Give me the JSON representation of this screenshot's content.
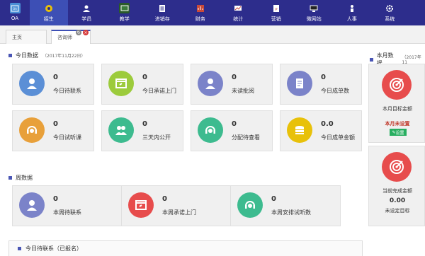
{
  "nav": [
    {
      "label": "OA",
      "icon": "oa-icon",
      "active": false
    },
    {
      "label": "招生",
      "icon": "enrollment-icon",
      "active": true
    },
    {
      "label": "学员",
      "icon": "student-icon",
      "active": false
    },
    {
      "label": "教学",
      "icon": "teaching-icon",
      "active": false
    },
    {
      "label": "进销存",
      "icon": "inventory-icon",
      "active": false
    },
    {
      "label": "财务",
      "icon": "finance-icon",
      "active": false
    },
    {
      "label": "统计",
      "icon": "statistics-icon",
      "active": false
    },
    {
      "label": "营销",
      "icon": "marketing-icon",
      "active": false
    },
    {
      "label": "微网站",
      "icon": "microsite-icon",
      "active": false
    },
    {
      "label": "人事",
      "icon": "hr-icon",
      "active": false
    },
    {
      "label": "系统",
      "icon": "system-icon",
      "active": false
    }
  ],
  "tabs": {
    "home": "主页",
    "current": "咨询师"
  },
  "today": {
    "title": "今日数据",
    "date": "（2017年11月22日）",
    "cards": [
      {
        "value": "0",
        "label": "今日待联系",
        "icon": "user-icon",
        "color": "#5b8fd6"
      },
      {
        "value": "0",
        "label": "今日承诺上门",
        "icon": "browser-icon",
        "color": "#9ccb3c"
      },
      {
        "value": "0",
        "label": "未读批阅",
        "icon": "user-icon",
        "color": "#7b83c9"
      },
      {
        "value": "0",
        "label": "今日成单数",
        "icon": "document-icon",
        "color": "#7b83c9"
      },
      {
        "value": "0",
        "label": "今日试听课",
        "icon": "headset-icon",
        "color": "#e8a03a"
      },
      {
        "value": "0",
        "label": "三天内公开",
        "icon": "users-icon",
        "color": "#3dbb8f"
      },
      {
        "value": "0",
        "label": "分配待查看",
        "icon": "headset-icon",
        "color": "#3dbb8f"
      },
      {
        "value": "0.0",
        "label": "今日成单金额",
        "icon": "coins-icon",
        "color": "#e8c10a"
      }
    ]
  },
  "week": {
    "title": "周数据",
    "cards": [
      {
        "value": "0",
        "label": "本周待联系",
        "icon": "user-icon",
        "color": "#7b83c9"
      },
      {
        "value": "0",
        "label": "本周承诺上门",
        "icon": "browser-icon",
        "color": "#e74c4c"
      },
      {
        "value": "0",
        "label": "本周安排试听数",
        "icon": "headset-icon",
        "color": "#3dbb8f"
      }
    ]
  },
  "month": {
    "title": "本月数据",
    "date": "（2017年11",
    "target_label": "本月目标金额",
    "unset_text": "本月未设置",
    "set_button": "设置",
    "done_label": "当前完成金额",
    "done_value": "0.00",
    "no_target": "未设定目标"
  },
  "bottom": {
    "title": "今日待联系（已报名）"
  }
}
